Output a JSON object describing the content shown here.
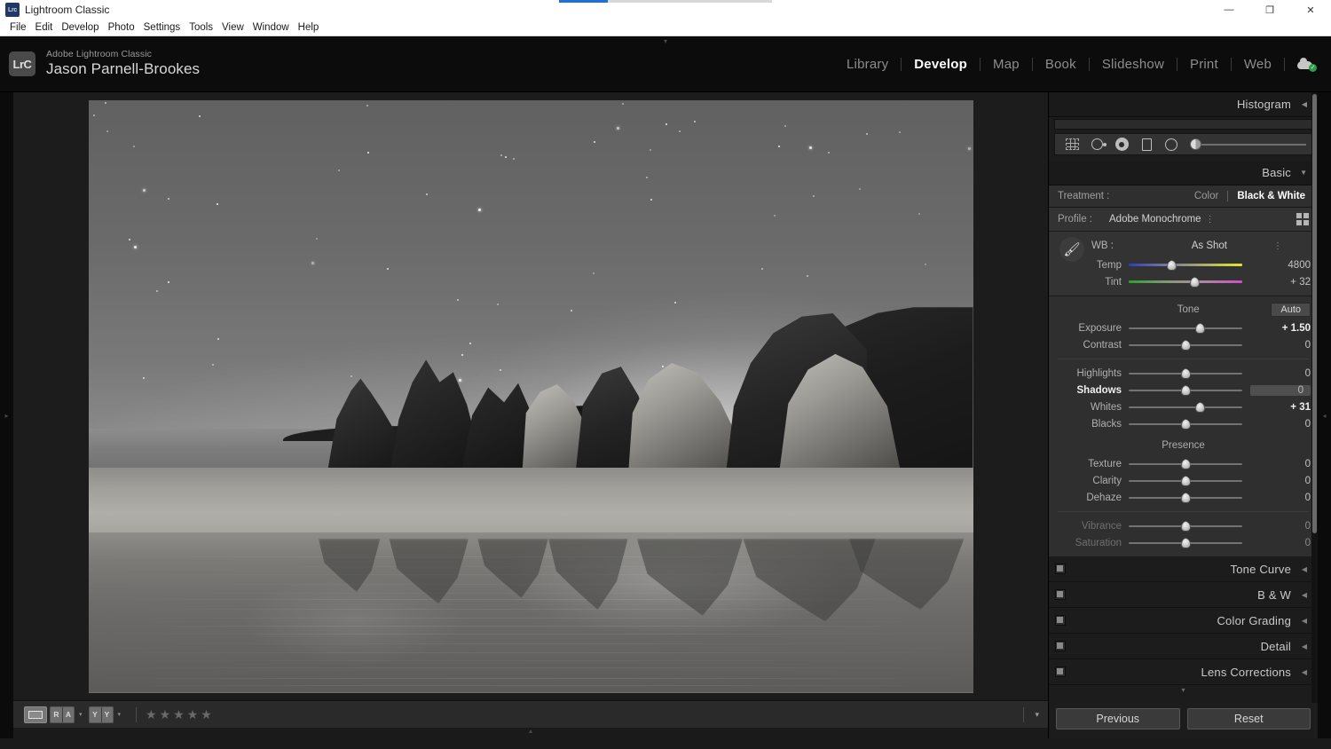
{
  "window": {
    "title": "Lightroom Classic",
    "app_badge": "Lrc",
    "minimize": "—",
    "maximize": "❐",
    "close": "✕"
  },
  "menubar": {
    "items": [
      "File",
      "Edit",
      "Develop",
      "Photo",
      "Settings",
      "Tools",
      "View",
      "Window",
      "Help"
    ]
  },
  "identity": {
    "logo": "LrC",
    "app_name": "Adobe Lightroom Classic",
    "user_name": "Jason Parnell-Brookes"
  },
  "modules": {
    "items": [
      "Library",
      "Develop",
      "Map",
      "Book",
      "Slideshow",
      "Print",
      "Web"
    ],
    "active": "Develop",
    "sync_icon": "cloud-sync-icon",
    "sync_check": "✓"
  },
  "histogram": {
    "title": "Histogram",
    "collapse_triangle": "◀",
    "tools": [
      "crop-overlay-icon",
      "spot-removal-icon",
      "masking-icon",
      "linear-gradient-icon",
      "radial-gradient-icon"
    ]
  },
  "basic": {
    "title": "Basic",
    "expand_triangle": "▼",
    "treatment": {
      "label": "Treatment :",
      "options": [
        "Color",
        "Black & White"
      ],
      "active": "Black & White"
    },
    "profile": {
      "label": "Profile :",
      "value": "Adobe Monochrome",
      "dots": "⋮",
      "browser_icon": "profile-browser-icon"
    },
    "wb": {
      "eyedropper": "white-balance-selector-icon",
      "label": "WB :",
      "value": "As Shot",
      "dots": "⋮",
      "sliders": [
        {
          "name": "Temp",
          "value": "4800",
          "pos": 38,
          "track": "temp"
        },
        {
          "name": "Tint",
          "value": "+ 32",
          "pos": 58,
          "track": "tint"
        }
      ]
    },
    "tone": {
      "title": "Tone",
      "auto": "Auto",
      "sliders": [
        {
          "name": "Exposure",
          "value": "+ 1.50",
          "pos": 63,
          "state": "bold"
        },
        {
          "name": "Contrast",
          "value": "0",
          "pos": 50,
          "state": "normal"
        }
      ],
      "sliders2": [
        {
          "name": "Highlights",
          "value": "0",
          "pos": 50,
          "state": "normal"
        },
        {
          "name": "Shadows",
          "value": "0",
          "pos": 50,
          "state": "hover"
        },
        {
          "name": "Whites",
          "value": "+ 31",
          "pos": 63,
          "state": "bold"
        },
        {
          "name": "Blacks",
          "value": "0",
          "pos": 50,
          "state": "normal"
        }
      ]
    },
    "presence": {
      "title": "Presence",
      "sliders": [
        {
          "name": "Texture",
          "value": "0",
          "pos": 50,
          "state": "normal"
        },
        {
          "name": "Clarity",
          "value": "0",
          "pos": 50,
          "state": "normal"
        },
        {
          "name": "Dehaze",
          "value": "0",
          "pos": 50,
          "state": "normal"
        }
      ],
      "sliders2": [
        {
          "name": "Vibrance",
          "value": "0",
          "pos": 50,
          "state": "disabled"
        },
        {
          "name": "Saturation",
          "value": "0",
          "pos": 50,
          "state": "disabled"
        }
      ]
    }
  },
  "collapsed_panels": [
    {
      "title": "Tone Curve",
      "triangle": "◀"
    },
    {
      "title": "B & W",
      "triangle": "◀"
    },
    {
      "title": "Color Grading",
      "triangle": "◀"
    },
    {
      "title": "Detail",
      "triangle": "◀"
    },
    {
      "title": "Lens Corrections",
      "triangle": "◀"
    }
  ],
  "right_buttons": {
    "previous": "Previous",
    "reset": "Reset"
  },
  "toolbar": {
    "loupe_view": "loupe-view-icon",
    "before_after_label": [
      "R",
      "A"
    ],
    "before_after_split_label": [
      "Y",
      "Y"
    ],
    "caret": "▾",
    "stars": [
      "★",
      "★",
      "★",
      "★",
      "★"
    ],
    "rating_count": 0,
    "right_chevron": "▾"
  },
  "edges": {
    "left_arrow": "▸",
    "right_arrow": "◂",
    "top_caret": "▾",
    "bottom_caret": "▴"
  },
  "photo": {
    "description": "black-and-white night seascape with starry sky, layered rock cliffs, beach and reflective wet sand",
    "star_count": 72,
    "distant_lights": 3
  },
  "colors": {
    "panel_bg": "#2f2f2f",
    "app_bg": "#1c1c1c",
    "accent_active": "#ffffff",
    "label": "#b0b0b0",
    "value": "#c3c3c3",
    "sync_green": "#2c9c4a",
    "progress_blue": "#1e6fd9"
  }
}
